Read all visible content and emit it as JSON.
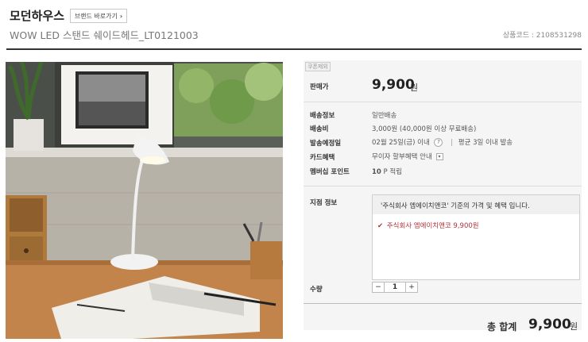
{
  "header": {
    "brand_name": "모던하우스",
    "brand_button_label": "브랜드 바로가기",
    "product_title": "WOW LED 스탠드 쉐이드헤드_LT0121003",
    "product_code": "상품코드 : 2108531298"
  },
  "image": {
    "description_alt": "WOW LED 스탠드 쉐이드헤드"
  },
  "info": {
    "coupon_tag": "쿠폰제외",
    "price_label": "판매가",
    "price": "9,900",
    "currency": "원",
    "shipping_label": "배송정보",
    "shipping_value": "일반배송",
    "shipping_fee_label": "배송비",
    "shipping_fee_value": "3,000원 (40,000원 이상 무료배송)",
    "ship_date_label": "발송예정일",
    "ship_date_value": "02월 25일(금) 이내",
    "ship_date_avg": "평균 3일 이내 발송",
    "card_label": "카드혜택",
    "card_value": "무이자 할부혜택 안내",
    "points_label": "멤버십 포인트",
    "points_value": "10",
    "points_suffix": "P 적립",
    "branch_label": "지점 정보",
    "branch_note": "'주식회사 엠에이치앤코' 기준의 가격 및 혜택 입니다.",
    "branch_item": "주식회사 엠에이치앤코 9,900원",
    "qty_label": "수량",
    "qty_minus": "−",
    "qty_value": "1",
    "qty_plus": "+"
  },
  "total": {
    "label": "총 합계",
    "amount": "9,900",
    "currency": "원"
  },
  "colors": {
    "accent_red": "#b0323a",
    "panel_bg": "#f5f5f5"
  }
}
